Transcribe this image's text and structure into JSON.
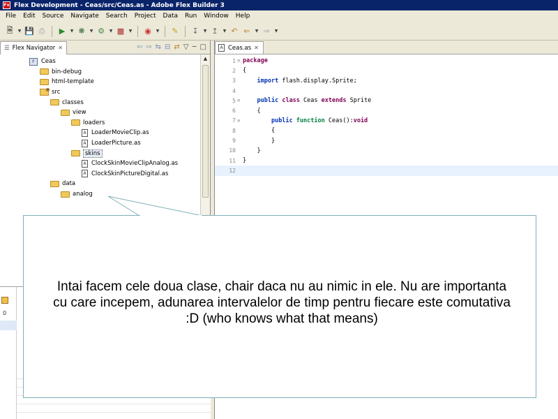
{
  "window": {
    "title": "Flex Development - Ceas/src/Ceas.as - Adobe Flex Builder 3",
    "app_icon": "Fx"
  },
  "menu": [
    "File",
    "Edit",
    "Source",
    "Navigate",
    "Search",
    "Project",
    "Data",
    "Run",
    "Window",
    "Help"
  ],
  "toolbar": {
    "icons": [
      "new-icon",
      "save-icon",
      "print-icon",
      "run-icon",
      "debug-icon",
      "profile-icon",
      "build-icon",
      "external-tools-icon",
      "annotation-icon",
      "next-annotation-icon",
      "prev-annotation-icon",
      "back-icon",
      "forward-icon"
    ]
  },
  "navigator": {
    "tab_label": "Flex Navigator",
    "close_glyph": "✕",
    "tree": [
      {
        "label": "Ceas",
        "type": "project",
        "depth": 0
      },
      {
        "label": "bin-debug",
        "type": "folder",
        "depth": 1
      },
      {
        "label": "html-template",
        "type": "folder",
        "depth": 1
      },
      {
        "label": "src",
        "type": "src",
        "depth": 1
      },
      {
        "label": "classes",
        "type": "folder",
        "depth": 2
      },
      {
        "label": "view",
        "type": "folder",
        "depth": 3
      },
      {
        "label": "loaders",
        "type": "folder",
        "depth": 4
      },
      {
        "label": "LoaderMovieClip.as",
        "type": "file",
        "depth": 5
      },
      {
        "label": "LoaderPicture.as",
        "type": "file",
        "depth": 5
      },
      {
        "label": "skins",
        "type": "folder",
        "depth": 4,
        "selected": true
      },
      {
        "label": "ClockSkinMovieClipAnalog.as",
        "type": "file",
        "depth": 5
      },
      {
        "label": "ClockSkinPictureDigital.as",
        "type": "file",
        "depth": 5
      },
      {
        "label": "data",
        "type": "folder",
        "depth": 2
      },
      {
        "label": "analog",
        "type": "folder",
        "depth": 3
      }
    ],
    "lower_panel_value": "0"
  },
  "editor": {
    "tab_label": "Ceas.as",
    "close_glyph": "✕",
    "lines": [
      {
        "n": "1",
        "fold": "⊖",
        "code": [
          [
            "kw",
            "package"
          ]
        ]
      },
      {
        "n": "2",
        "fold": "",
        "code": [
          [
            "",
            "{"
          ]
        ]
      },
      {
        "n": "3",
        "fold": "",
        "code": [
          [
            "",
            "    "
          ],
          [
            "kw-blue",
            "import"
          ],
          [
            "",
            " flash.display.Sprite;"
          ]
        ]
      },
      {
        "n": "4",
        "fold": "",
        "code": [
          [
            "",
            ""
          ]
        ]
      },
      {
        "n": "5",
        "fold": "⊖",
        "code": [
          [
            "",
            "    "
          ],
          [
            "kw-blue",
            "public"
          ],
          [
            "",
            " "
          ],
          [
            "kw",
            "class"
          ],
          [
            "",
            " Ceas "
          ],
          [
            "kw",
            "extends"
          ],
          [
            "",
            " Sprite"
          ]
        ]
      },
      {
        "n": "6",
        "fold": "",
        "code": [
          [
            "",
            "    {"
          ]
        ]
      },
      {
        "n": "7",
        "fold": "⊖",
        "code": [
          [
            "",
            "        "
          ],
          [
            "kw-blue",
            "public"
          ],
          [
            "",
            " "
          ],
          [
            "kw-green",
            "function"
          ],
          [
            "",
            " Ceas():"
          ],
          [
            "kw",
            "void"
          ]
        ]
      },
      {
        "n": "8",
        "fold": "",
        "code": [
          [
            "",
            "        {"
          ]
        ]
      },
      {
        "n": "9",
        "fold": "",
        "code": [
          [
            "",
            "        }"
          ]
        ]
      },
      {
        "n": "10",
        "fold": "",
        "code": [
          [
            "",
            "    }"
          ]
        ]
      },
      {
        "n": "11",
        "fold": "",
        "code": [
          [
            "",
            "}"
          ]
        ]
      },
      {
        "n": "12",
        "fold": "",
        "code": [
          [
            "",
            ""
          ]
        ],
        "current": true
      }
    ]
  },
  "callout": {
    "text": "Intai facem cele doua clase, chair daca nu au nimic in ele. Nu are importanta cu care incepem, adunarea intervalelor de timp pentru fiecare este comutativa :D (who knows what that means)"
  },
  "colors": {
    "titlebar": "#0a246a",
    "keyword": "#7f0055",
    "keyword_blue": "#0033b3",
    "keyword_green": "#008040",
    "current_line": "#e8f2fe",
    "callout_border": "#7fb0b8"
  }
}
